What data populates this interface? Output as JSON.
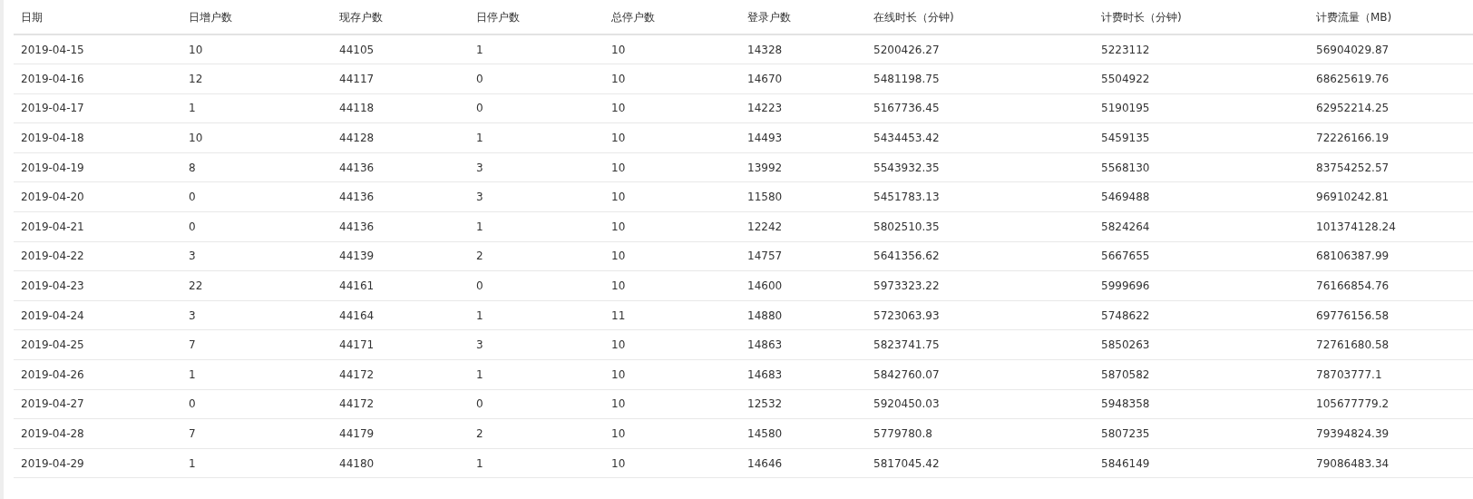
{
  "table": {
    "columns": [
      "日期",
      "日增户数",
      "现存户数",
      "日停户数",
      "总停户数",
      "登录户数",
      "在线时长（分钟)",
      "计费时长（分钟)",
      "计费流量（MB)"
    ],
    "rows": [
      [
        "2019-04-15",
        "10",
        "44105",
        "1",
        "10",
        "14328",
        "5200426.27",
        "5223112",
        "56904029.87"
      ],
      [
        "2019-04-16",
        "12",
        "44117",
        "0",
        "10",
        "14670",
        "5481198.75",
        "5504922",
        "68625619.76"
      ],
      [
        "2019-04-17",
        "1",
        "44118",
        "0",
        "10",
        "14223",
        "5167736.45",
        "5190195",
        "62952214.25"
      ],
      [
        "2019-04-18",
        "10",
        "44128",
        "1",
        "10",
        "14493",
        "5434453.42",
        "5459135",
        "72226166.19"
      ],
      [
        "2019-04-19",
        "8",
        "44136",
        "3",
        "10",
        "13992",
        "5543932.35",
        "5568130",
        "83754252.57"
      ],
      [
        "2019-04-20",
        "0",
        "44136",
        "3",
        "10",
        "11580",
        "5451783.13",
        "5469488",
        "96910242.81"
      ],
      [
        "2019-04-21",
        "0",
        "44136",
        "1",
        "10",
        "12242",
        "5802510.35",
        "5824264",
        "101374128.24"
      ],
      [
        "2019-04-22",
        "3",
        "44139",
        "2",
        "10",
        "14757",
        "5641356.62",
        "5667655",
        "68106387.99"
      ],
      [
        "2019-04-23",
        "22",
        "44161",
        "0",
        "10",
        "14600",
        "5973323.22",
        "5999696",
        "76166854.76"
      ],
      [
        "2019-04-24",
        "3",
        "44164",
        "1",
        "11",
        "14880",
        "5723063.93",
        "5748622",
        "69776156.58"
      ],
      [
        "2019-04-25",
        "7",
        "44171",
        "3",
        "10",
        "14863",
        "5823741.75",
        "5850263",
        "72761680.58"
      ],
      [
        "2019-04-26",
        "1",
        "44172",
        "1",
        "10",
        "14683",
        "5842760.07",
        "5870582",
        "78703777.1"
      ],
      [
        "2019-04-27",
        "0",
        "44172",
        "0",
        "10",
        "12532",
        "5920450.03",
        "5948358",
        "105677779.2"
      ],
      [
        "2019-04-28",
        "7",
        "44179",
        "2",
        "10",
        "14580",
        "5779780.8",
        "5807235",
        "79394824.39"
      ],
      [
        "2019-04-29",
        "1",
        "44180",
        "1",
        "10",
        "14646",
        "5817045.42",
        "5846149",
        "79086483.34"
      ]
    ]
  }
}
